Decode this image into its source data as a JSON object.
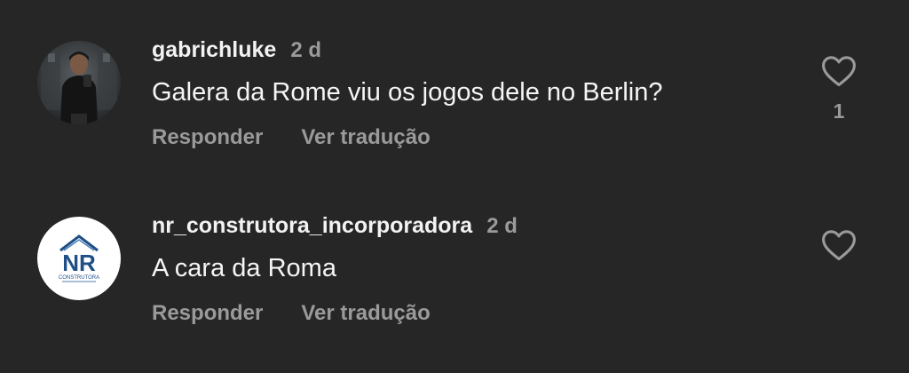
{
  "comments": [
    {
      "username": "gabrichluke",
      "time": "2 d",
      "text": "Galera da Rome viu os jogos dele no Berlin?",
      "reply_label": "Responder",
      "translate_label": "Ver tradução",
      "like_count": "1",
      "avatar": "person-photo-avatar"
    },
    {
      "username": "nr_construtora_incorporadora",
      "time": "2 d",
      "text": "A cara da Roma",
      "reply_label": "Responder",
      "translate_label": "Ver tradução",
      "like_count": "",
      "avatar": "nr-logo-avatar",
      "logo_text": "NR",
      "logo_subtext": "CONSTRUTORA",
      "logo_color": "#1f4f86"
    }
  ],
  "colors": {
    "background": "#262626",
    "text": "#f5f5f5",
    "secondary": "#9a9a9a"
  }
}
